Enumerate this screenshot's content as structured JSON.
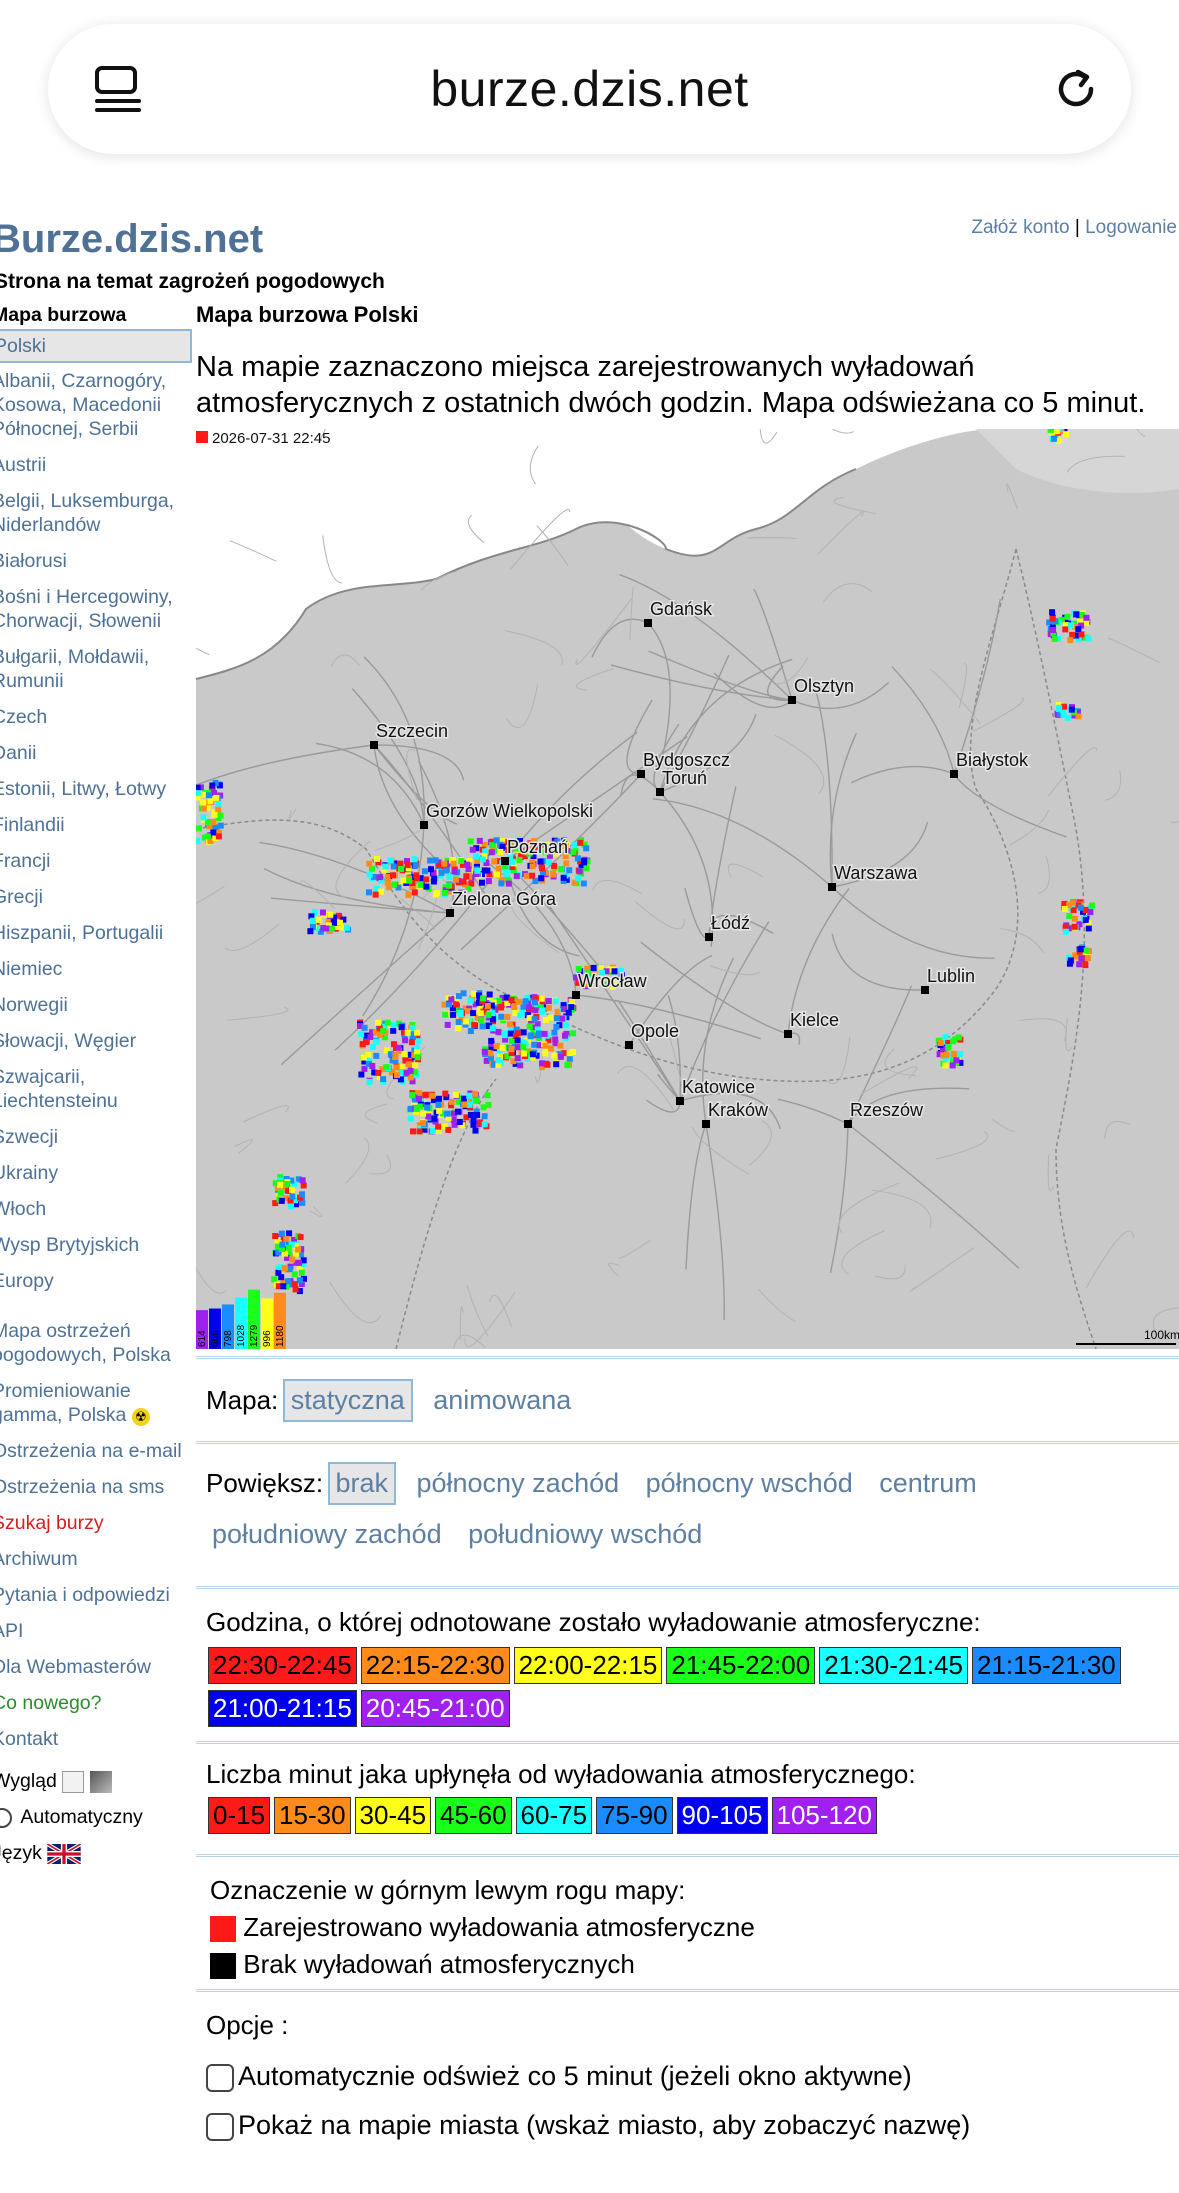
{
  "browser": {
    "url": "burze.dzis.net"
  },
  "header": {
    "login_register": "Załóż konto",
    "sep": "|",
    "login": "Logowanie",
    "site_title": "Burze.dzis.net",
    "site_subtitle": "Strona na temat zagrożeń pogodowych"
  },
  "sidebar": {
    "heading": "Mapa burzowa",
    "selected": "Polski",
    "items": [
      "Albanii, Czarnogóry, Kosowa, Macedonii Północnej, Serbii",
      "Austrii",
      "Belgii, Luksemburga, Niderlandów",
      "Białorusi",
      "Bośni i Hercegowiny, Chorwacji, Słowenii",
      "Bułgarii, Mołdawii, Rumunii",
      "Czech",
      "Danii",
      "Estonii, Litwy, Łotwy",
      "Finlandii",
      "Francji",
      "Grecji",
      "Hiszpanii, Portugalii",
      "Niemiec",
      "Norwegii",
      "Słowacji, Węgier",
      "Szwajcarii, Liechtensteinu",
      "Szwecji",
      "Ukrainy",
      "Włoch",
      "Wysp Brytyjskich",
      "Europy"
    ],
    "links": [
      "Mapa ostrzeżeń pogodowych, Polska",
      "Promieniowanie gamma, Polska",
      "Ostrzeżenia na e-mail",
      "Ostrzeżenia na sms"
    ],
    "search_storm": "Szukaj burzy",
    "archive": "Archiwum",
    "faq": "Pytania i odpowiedzi",
    "api": "API",
    "webmasters": "Dla Webmasterów",
    "whats_new": "Co nowego?",
    "contact": "Kontakt",
    "appearance_label": "Wygląd",
    "auto_label": "Automatyczny",
    "language_label": "Język"
  },
  "main": {
    "title": "Mapa burzowa Polski",
    "description": "Na mapie zaznaczono miejsca zarejestrowanych wyładowań atmosferycznych z ostatnich dwóch godzin. Mapa odświeżana co 5 minut.",
    "map": {
      "timestamp": "2026-07-31 22:45",
      "scale": "100km",
      "cities": [
        "Gdańsk",
        "Olsztyn",
        "Szczecin",
        "Bydgoszcz",
        "Toruń",
        "Białystok",
        "Gorzów Wielkopolski",
        "Poznań",
        "Warszawa",
        "Zielona Góra",
        "Łódź",
        "Lublin",
        "Wrocław",
        "Kielce",
        "Opole",
        "Katowice",
        "Kraków",
        "Rzeszów"
      ],
      "legend_counts": [
        "614",
        "665",
        "798",
        "1028",
        "1279",
        "996",
        "1180"
      ]
    },
    "map_mode": {
      "label": "Mapa:",
      "options": [
        "statyczna",
        "animowana"
      ],
      "selected": "statyczna"
    },
    "zoom": {
      "label": "Powiększ:",
      "options": [
        "brak",
        "północny zachód",
        "północny wschód",
        "centrum",
        "południowy zachód",
        "południowy wschód"
      ],
      "selected": "brak"
    },
    "hour_legend": {
      "label": "Godzina, o której odnotowane zostało wyładowanie atmosferyczne:",
      "items": [
        {
          "text": "22:30-22:45",
          "bg": "#ff1a1a",
          "fg": "#000"
        },
        {
          "text": "22:15-22:30",
          "bg": "#ff8c1a",
          "fg": "#000"
        },
        {
          "text": "22:00-22:15",
          "bg": "#ffff1a",
          "fg": "#000"
        },
        {
          "text": "21:45-22:00",
          "bg": "#1aff1a",
          "fg": "#000"
        },
        {
          "text": "21:30-21:45",
          "bg": "#1affff",
          "fg": "#000"
        },
        {
          "text": "21:15-21:30",
          "bg": "#1a8cff",
          "fg": "#000"
        },
        {
          "text": "21:00-21:15",
          "bg": "#0000ee",
          "fg": "#fff"
        },
        {
          "text": "20:45-21:00",
          "bg": "#a020f0",
          "fg": "#fff"
        }
      ]
    },
    "minutes_legend": {
      "label": "Liczba minut jaka upłynęła od wyładowania atmosferycznego:",
      "items": [
        {
          "text": "0-15",
          "bg": "#ff1a1a",
          "fg": "#000"
        },
        {
          "text": "15-30",
          "bg": "#ff8c1a",
          "fg": "#000"
        },
        {
          "text": "30-45",
          "bg": "#ffff1a",
          "fg": "#000"
        },
        {
          "text": "45-60",
          "bg": "#1aff1a",
          "fg": "#000"
        },
        {
          "text": "60-75",
          "bg": "#1affff",
          "fg": "#000"
        },
        {
          "text": "75-90",
          "bg": "#1a8cff",
          "fg": "#000"
        },
        {
          "text": "90-105",
          "bg": "#0000ee",
          "fg": "#fff"
        },
        {
          "text": "105-120",
          "bg": "#a020f0",
          "fg": "#fff"
        }
      ]
    },
    "corner_legend": {
      "label": "Oznaczenie w górnym lewym rogu mapy:",
      "registered": "Zarejestrowano wyładowania atmosferyczne",
      "none": "Brak wyładowań atmosferycznych"
    },
    "options": {
      "label": "Opcje :",
      "auto_refresh": "Automatycznie odśwież co 5 minut (jeżeli okno aktywne)",
      "show_cities": "Pokaż na mapie miasta (wskaż miasto, aby zobaczyć nazwę)"
    }
  }
}
